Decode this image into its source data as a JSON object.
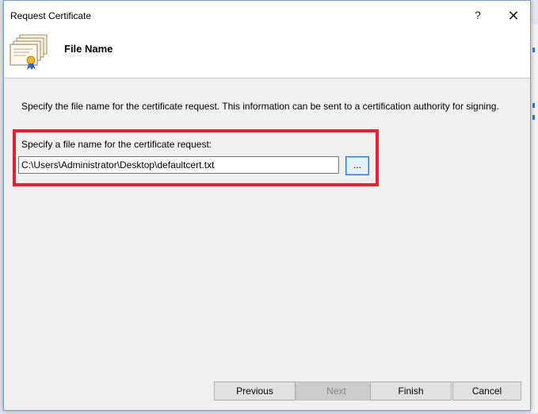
{
  "window": {
    "title": "Request Certificate",
    "help_glyph": "?",
    "close_glyph": "✕"
  },
  "header": {
    "title": "File Name",
    "icon": "certificate-icon"
  },
  "main": {
    "description": "Specify the file name for the certificate request. This information can be sent to a certification authority for signing.",
    "field_label": "Specify a file name for the certificate request:",
    "file_path_value": "C:\\Users\\Administrator\\Desktop\\defaultcert.txt",
    "browse_label": "...",
    "highlight_color": "#e0232f"
  },
  "footer": {
    "previous_label": "Previous",
    "next_label": "Next",
    "finish_label": "Finish",
    "cancel_label": "Cancel"
  }
}
